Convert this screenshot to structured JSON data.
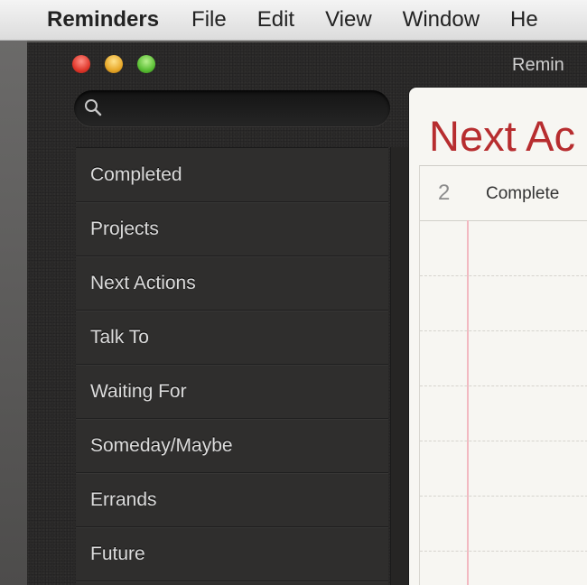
{
  "menubar": {
    "app": "Reminders",
    "items": [
      "File",
      "Edit",
      "View",
      "Window",
      "He"
    ]
  },
  "window": {
    "title": "Remin"
  },
  "search": {
    "value": "",
    "placeholder": ""
  },
  "sidebar": {
    "items": [
      {
        "label": "Completed"
      },
      {
        "label": "Projects"
      },
      {
        "label": "Next Actions"
      },
      {
        "label": "Talk To"
      },
      {
        "label": "Waiting For"
      },
      {
        "label": "Someday/Maybe"
      },
      {
        "label": "Errands"
      },
      {
        "label": "Future"
      }
    ]
  },
  "list": {
    "title": "Next Ac",
    "completed_count": "2",
    "completed_label": "Complete"
  },
  "colors": {
    "list_title": "#b72d2f",
    "margin_line": "#f2b9c1",
    "sidebar_bg": "#2f2e2d"
  }
}
